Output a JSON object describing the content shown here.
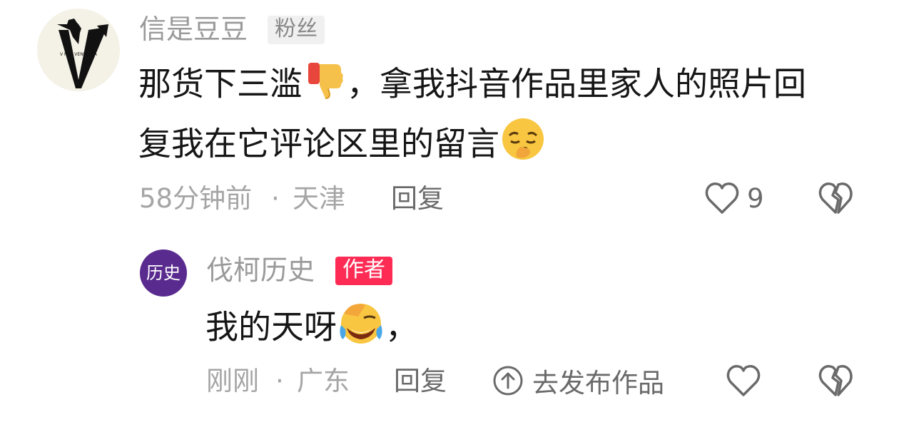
{
  "main_comment": {
    "username": "信是豆豆",
    "badge": "粉丝",
    "avatar_text": "V FOR VENDETTA",
    "text_line1_part1": "那货下三滥",
    "text_line1_part2": "，拿我抖音作品里家人的照片回",
    "text_line2": "复我在它评论区里的留言",
    "emoji_1": "thumbs-down",
    "emoji_2": "pensive-face",
    "time": "58分钟前",
    "separator": "·",
    "location": "天津",
    "reply_label": "回复",
    "like_count": "9"
  },
  "reply_comment": {
    "username": "伐柯历史",
    "badge": "作者",
    "avatar_text": "历史",
    "text_part1": "我的天呀",
    "text_part2": "，",
    "emoji": "crying-laughing-face",
    "time": "刚刚",
    "separator": "·",
    "location": "广东",
    "reply_label": "回复",
    "publish_label": "去发布作品"
  },
  "colors": {
    "author_badge": "#fe2c55",
    "reply_avatar": "#5a2b8f",
    "muted_text": "#a5a5a5"
  }
}
